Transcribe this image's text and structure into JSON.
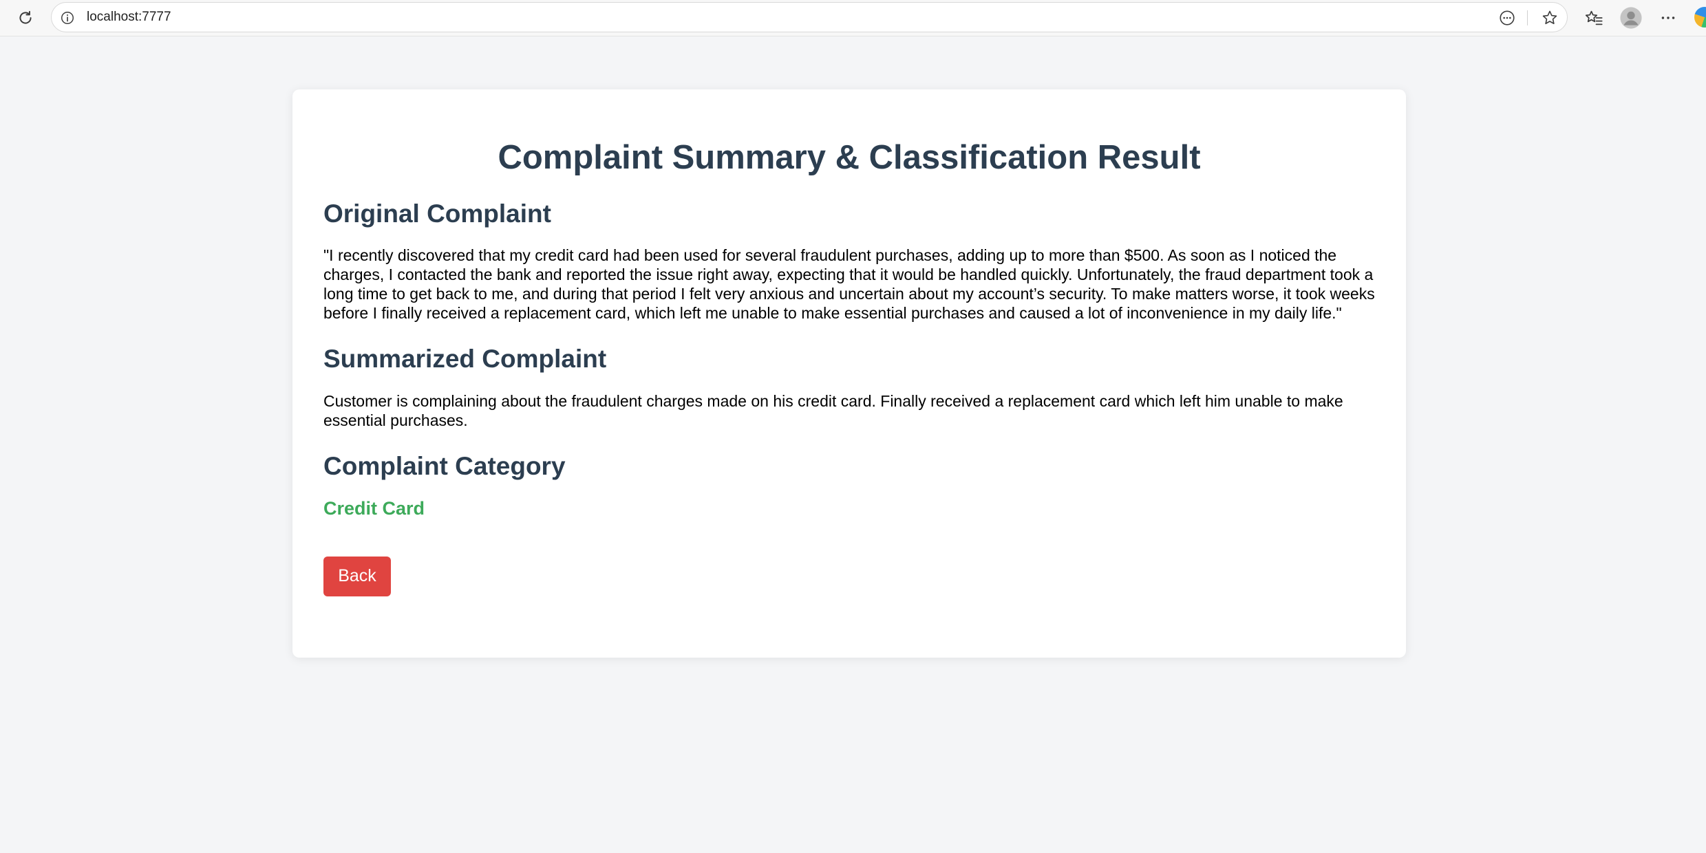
{
  "browser": {
    "url": "localhost:7777"
  },
  "page": {
    "title": "Complaint Summary & Classification Result",
    "sections": {
      "original": {
        "heading": "Original Complaint",
        "text": "\"I recently discovered that my credit card had been used for several fraudulent purchases, adding up to more than $500. As soon as I noticed the charges, I contacted the bank and reported the issue right away, expecting that it would be handled quickly. Unfortunately, the fraud department took a long time to get back to me, and during that period I felt very anxious and uncertain about my account’s security. To make matters worse, it took weeks before I finally received a replacement card, which left me unable to make essential purchases and caused a lot of inconvenience in my daily life.\""
      },
      "summary": {
        "heading": "Summarized Complaint",
        "text": "Customer is complaining about the fraudulent charges made on his credit card. Finally received a replacement card which left him unable to make essential purchases."
      },
      "category": {
        "heading": "Complaint Category",
        "value": "Credit Card"
      }
    },
    "back_label": "Back"
  },
  "colors": {
    "heading": "#2c3e50",
    "category": "#3daa5a",
    "back_button": "#e04440",
    "background": "#f4f5f7"
  },
  "icons": {
    "reload": "reload-icon",
    "site_info": "info-icon",
    "reading_mode": "reading-mode-icon",
    "favorite": "star-icon",
    "favorites": "favorites-icon",
    "profile": "profile-icon",
    "menu": "more-icon",
    "logo": "copilot-icon"
  }
}
